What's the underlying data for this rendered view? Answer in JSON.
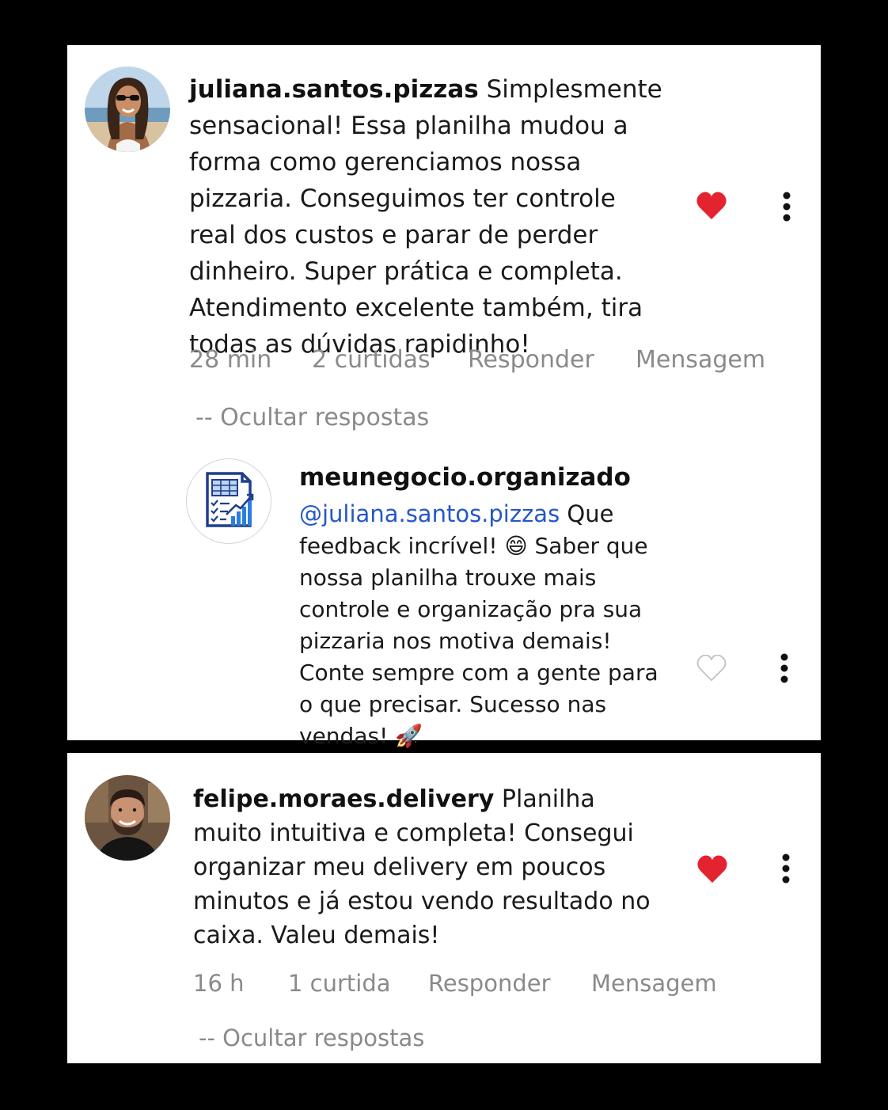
{
  "comments": [
    {
      "username": "juliana.santos.pizzas",
      "text": "Simplesmente sensacional! Essa planilha mudou a forma como gerenciamos nossa pizzaria. Conseguimos ter controle real dos custos e parar de perder dinheiro. Super prática e completa. Atendimento excelente também, tira todas as dúvidas rapidinho!",
      "time": "28 min",
      "likes": "2 curtidas",
      "reply_label": "Responder",
      "message_label": "Mensagem",
      "hide_replies": "-- Ocultar respostas",
      "liked": true,
      "reply": {
        "username": "meunegocio.organizado",
        "mention": "@juliana.santos.pizzas",
        "text_line1": " Que",
        "text_rest": "feedback incrível! 😄 Saber que nossa planilha trouxe mais controle e organização pra sua pizzaria nos motiva demais! Conte sempre com a gente para o que precisar. Sucesso nas vendas! 🚀",
        "liked": false
      }
    },
    {
      "username": "felipe.moraes.delivery",
      "text": "Planilha muito intuitiva e completa! Consegui organizar meu delivery em poucos minutos e já estou vendo resultado no caixa. Valeu demais!",
      "time": "16 h",
      "likes": "1 curtida",
      "reply_label": "Responder",
      "message_label": "Mensagem",
      "hide_replies": "-- Ocultar respostas",
      "liked": true
    }
  ],
  "colors": {
    "heart_filled": "#e3232f",
    "meta_text": "#8a8a8a",
    "mention": "#2458c6",
    "background": "#000000",
    "card": "#ffffff"
  },
  "icons": [
    "heart-filled-icon",
    "heart-outline-icon",
    "more-options-icon",
    "spreadsheet-chart-icon"
  ]
}
